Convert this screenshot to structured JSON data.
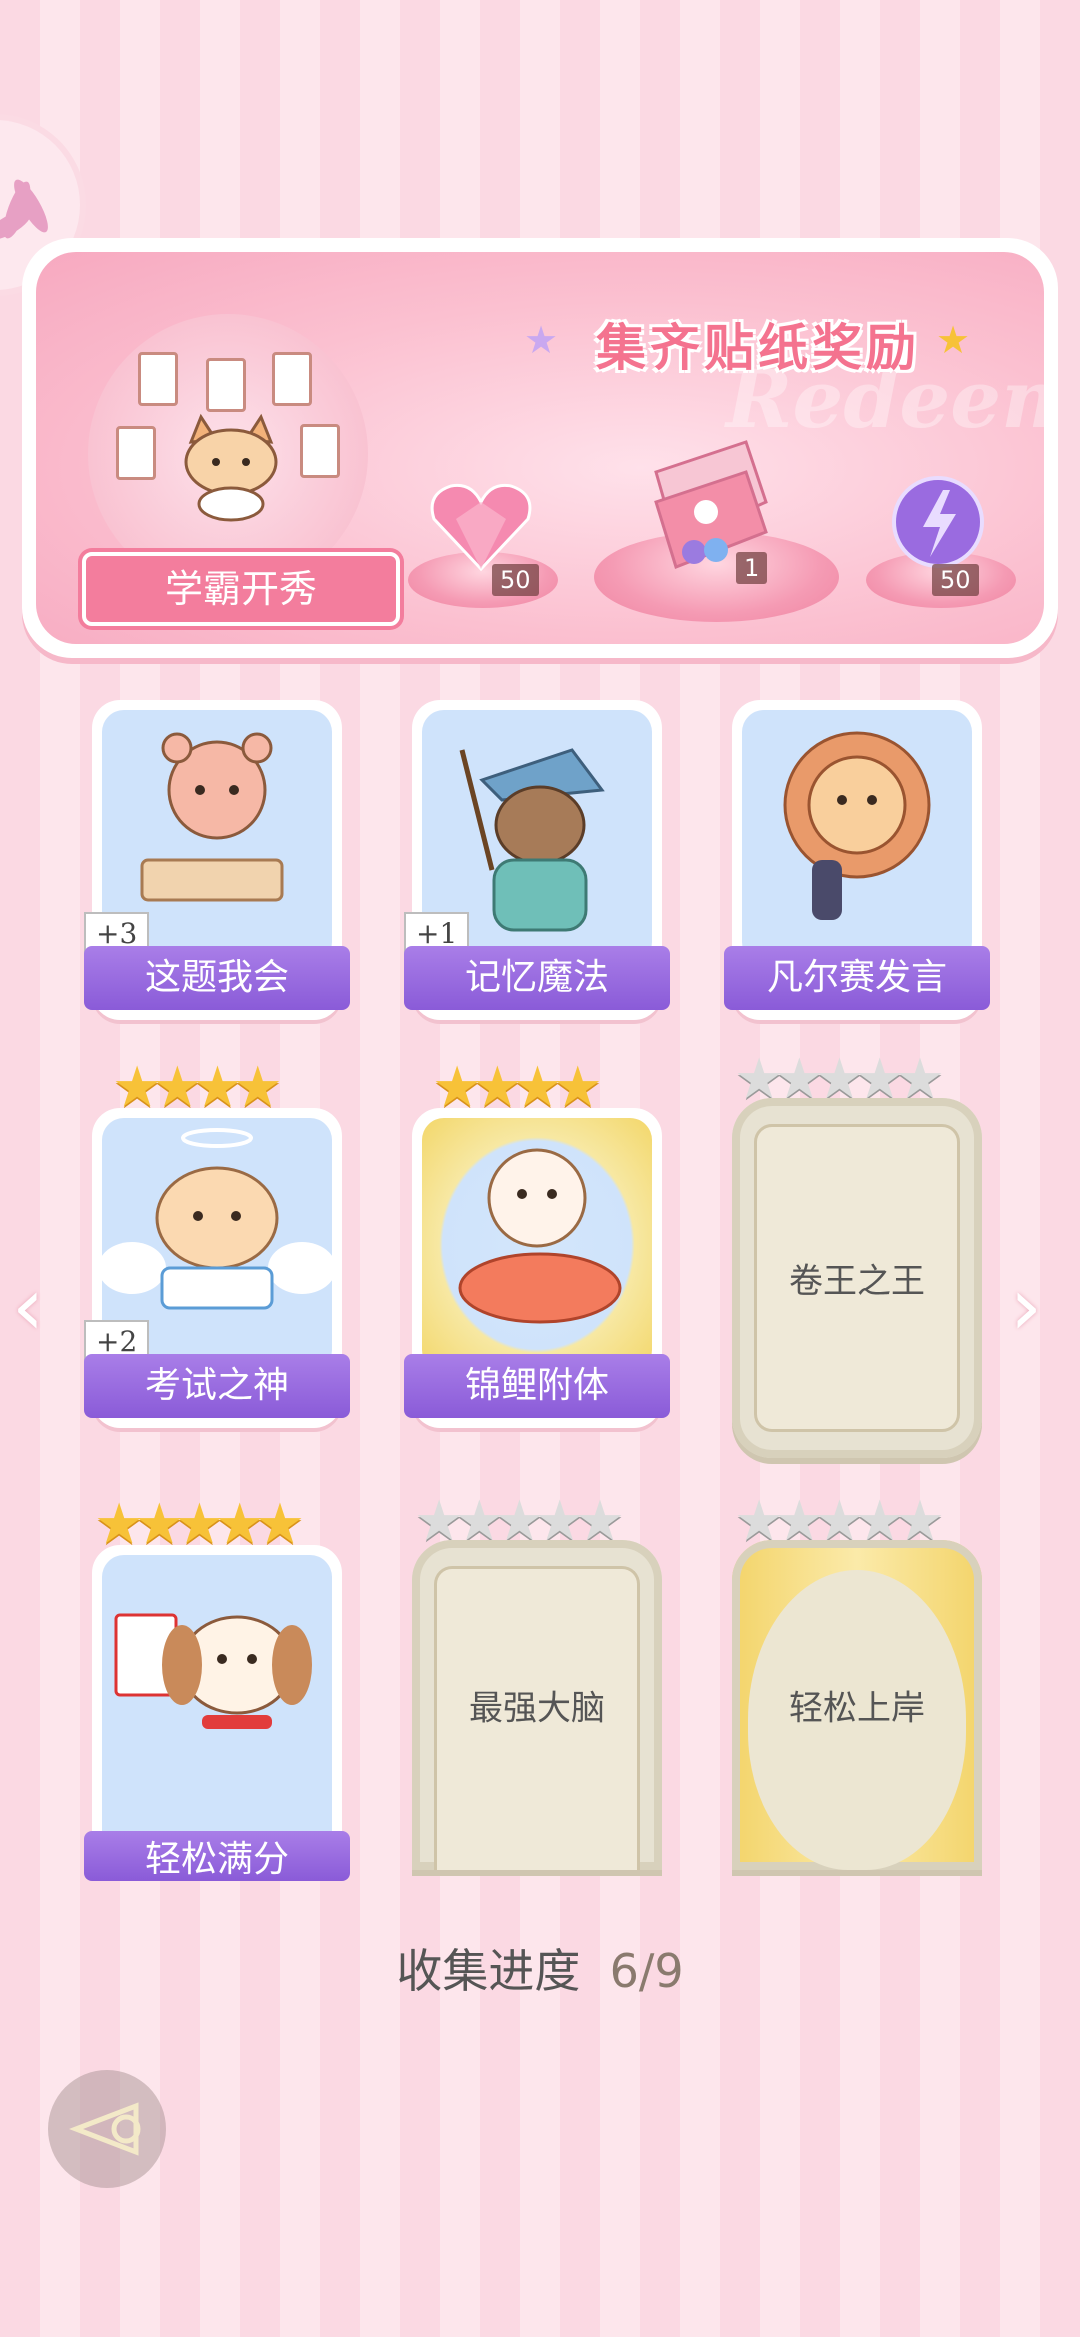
{
  "banner": {
    "title": "集齐贴纸奖励",
    "watermark": "Redeem",
    "badge_label": "学霸开秀",
    "rewards": [
      {
        "icon": "heart-gem-icon",
        "count": "50"
      },
      {
        "icon": "gift-box-icon",
        "count": "1"
      },
      {
        "icon": "lightning-orb-icon",
        "count": "50"
      }
    ]
  },
  "cards": [
    {
      "name": "这题我会",
      "plus": "+3",
      "state": "collected"
    },
    {
      "name": "记忆魔法",
      "plus": "+1",
      "state": "collected"
    },
    {
      "name": "凡尔赛发言",
      "plus": "",
      "state": "collected"
    },
    {
      "name": "考试之神",
      "plus": "+2",
      "state": "collected",
      "stars": 4
    },
    {
      "name": "锦鲤附体",
      "plus": "",
      "state": "collected",
      "stars": 4
    },
    {
      "name": "卷王之王",
      "state": "locked",
      "stars": 5
    },
    {
      "name": "轻松满分",
      "state": "collected",
      "stars": 5
    },
    {
      "name": "最强大脑",
      "state": "locked",
      "stars": 5
    },
    {
      "name": "轻松上岸",
      "state": "locked",
      "stars": 5
    }
  ],
  "progress": {
    "label": "收集进度",
    "value": "6/9"
  },
  "colors": {
    "accent": "#f37d9d",
    "label_purple": "#8a5bd8",
    "gold_star": "#f7c238"
  }
}
